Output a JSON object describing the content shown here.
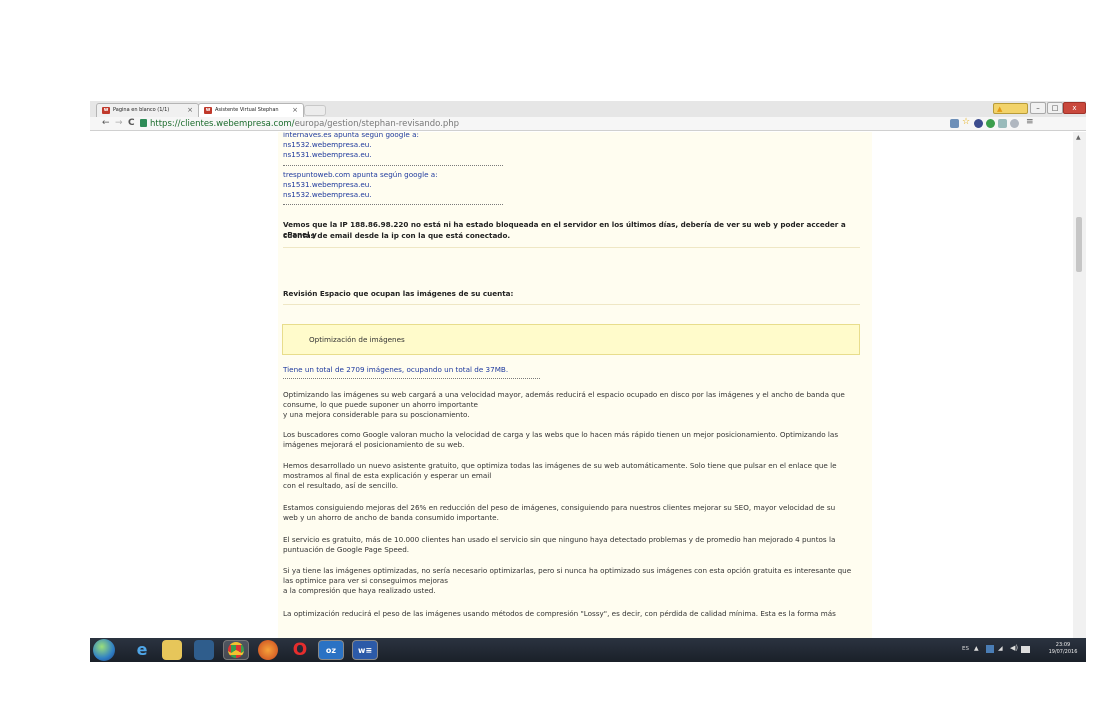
{
  "browser": {
    "tabs": [
      {
        "title": "Pagina en blanco (1/1)",
        "active": false
      },
      {
        "title": "Asistente Virtual Stephan",
        "active": true
      }
    ],
    "favicon_letter": "w",
    "tab_close": "×",
    "url_host": "https://clientes.webempresa.com/",
    "url_path": "europa/gestion/stephan-revisando.php",
    "icons": {
      "back": "←",
      "forward": "→",
      "reload": "C",
      "star": "☆",
      "menu": "≡",
      "min": "–",
      "max": "□",
      "close": "x",
      "warn": "▲"
    }
  },
  "content": {
    "dns1_title": "internaves.es apunta según google a:",
    "dns1_ns1": "ns1532.webempresa.eu.",
    "dns1_ns2": "ns1531.webempresa.eu.",
    "dns2_title": "trespuntoweb.com apunta según google a:",
    "dns2_ns1": "ns1531.webempresa.eu.",
    "dns2_ns2": "ns1532.webempresa.eu.",
    "ip_notice_1": "Vemos que la IP 188.86.98.220 no está ni ha estado bloqueada en el servidor en los últimos días, debería de ver su web y poder acceder a cPanel y",
    "ip_notice_2": "cuentas de email desde la ip con la que está conectado.",
    "images_heading": "Revisión Espacio que ocupan las imágenes de su cuenta:",
    "optimization_box": "Optimización de imágenes",
    "images_total": "Tiene un total de 2709 imágenes, ocupando un total de 37MB.",
    "p1_l1": "Optimizando las imágenes su web cargará a una velocidad mayor, además reducirá el espacio ocupado en disco por las imágenes y el ancho de banda que",
    "p1_l2": "consume, lo que puede suponer un ahorro importante",
    "p1_l3": "y una mejora considerable para su poscionamiento.",
    "p2_l1": "Los buscadores como Google valoran mucho la velocidad de carga y las webs que lo hacen más rápido tienen un mejor posicionamiento. Optimizando las",
    "p2_l2": "imágenes mejorará el posicionamiento de su web.",
    "p3_l1": "Hemos desarrollado un nuevo asistente gratuito, que optimiza todas las imágenes de su web automáticamente. Solo tiene que pulsar en el enlace que le",
    "p3_l2": "mostramos al final de esta explicación y esperar un email",
    "p3_l3": "con el resultado, así de sencillo.",
    "p4_l1": "Estamos consiguiendo mejoras del 26% en reducción del peso de imágenes, consiguiendo para nuestros clientes mejorar su SEO, mayor velocidad de su",
    "p4_l2": "web y un ahorro de ancho de banda consumido importante.",
    "p5_l1": "El servicio es gratuito, más de 10.000 clientes han usado el servicio sin que ninguno haya detectado problemas y de promedio han mejorado 4 puntos la",
    "p5_l2": "puntuación de Google Page Speed.",
    "p6_l1": "Si ya tiene las imágenes optimizadas, no sería necesario optimizarlas, pero si nunca ha optimizado sus imágenes con esta opción gratuita es interesante que",
    "p6_l2": "las optimice para ver si conseguimos mejoras",
    "p6_l3": "a la compresión que haya realizado usted.",
    "p7_l1": "La optimización reducirá el peso de las imágenes usando métodos de compresión \"Lossy\", es decir, con pérdida de calidad mínima. Esta es la forma más"
  },
  "taskbar": {
    "ie_glyph": "e",
    "opera_glyph": "O",
    "outlook_glyph": "oz",
    "word_glyph": "w≡",
    "tray_lang": "ES",
    "tray_arrow": "▲",
    "tray_net": "◢",
    "tray_vol": "◀)",
    "time": "23:09",
    "date": "19/07/2016"
  }
}
